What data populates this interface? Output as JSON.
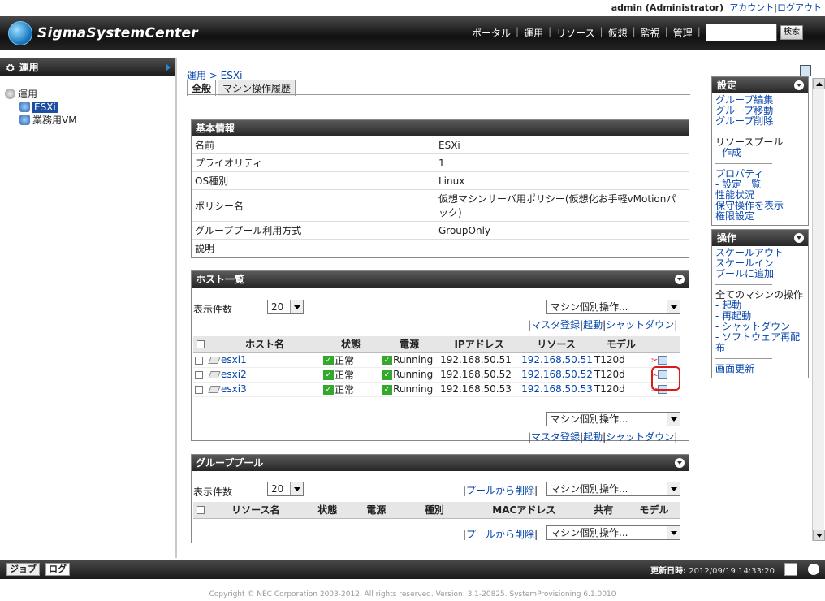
{
  "header": {
    "user": "admin (Administrator)",
    "account_link": "アカウント",
    "logout_link": "ログアウト",
    "app_name": "SigmaSystemCenter",
    "nav": [
      "ポータル",
      "運用",
      "リソース",
      "仮想",
      "監視",
      "管理"
    ],
    "search_button": "検索"
  },
  "left": {
    "title": "運用",
    "tree": [
      {
        "label": "運用"
      },
      {
        "label": "ESXi",
        "selected": true
      },
      {
        "label": "業務用VM"
      }
    ]
  },
  "main": {
    "breadcrumb": "運用 > ESXi",
    "tabs": [
      "全般",
      "マシン操作履歴"
    ],
    "basic": {
      "title": "基本情報",
      "rows": [
        {
          "k": "名前",
          "v": "ESXi"
        },
        {
          "k": "プライオリティ",
          "v": "1"
        },
        {
          "k": "OS種別",
          "v": "Linux"
        },
        {
          "k": "ポリシー名",
          "v": "仮想マシンサーバ用ポリシー(仮想化お手軽vMotionパック)"
        },
        {
          "k": "グループプール利用方式",
          "v": "GroupOnly"
        },
        {
          "k": "説明",
          "v": ""
        }
      ]
    },
    "hosts": {
      "title": "ホスト一覧",
      "count_label": "表示件数",
      "count_value": "20",
      "op_select": "マシン個別操作...",
      "links": [
        "マスタ登録",
        "起動",
        "シャットダウン"
      ],
      "columns": [
        "ホスト名",
        "状態",
        "電源",
        "IPアドレス",
        "リソース",
        "モデル"
      ],
      "rows": [
        {
          "name": "esxi1",
          "state": "正常",
          "power": "Running",
          "ip": "192.168.50.51",
          "res": "192.168.50.51",
          "model": "T120d"
        },
        {
          "name": "esxi2",
          "state": "正常",
          "power": "Running",
          "ip": "192.168.50.52",
          "res": "192.168.50.52",
          "model": "T120d"
        },
        {
          "name": "esxi3",
          "state": "正常",
          "power": "Running",
          "ip": "192.168.50.53",
          "res": "192.168.50.53",
          "model": "T120d"
        }
      ]
    },
    "pool": {
      "title": "グループプール",
      "count_label": "表示件数",
      "count_value": "20",
      "remove_link": "プールから削除",
      "op_select": "マシン個別操作...",
      "columns": [
        "リソース名",
        "状態",
        "電源",
        "種別",
        "MACアドレス",
        "共有",
        "モデル"
      ]
    }
  },
  "right": {
    "settings": {
      "title": "設定",
      "group1": [
        "グループ編集",
        "グループ移動",
        "グループ削除"
      ],
      "pool_label": "リソースプール",
      "pool_link": "- 作成",
      "prop_label": "プロパティ",
      "prop_links": [
        "- 設定一覧",
        "性能状況",
        "保守操作を表示",
        "権限設定"
      ]
    },
    "ops": {
      "title": "操作",
      "links": [
        "スケールアウト",
        "スケールイン",
        "プールに追加"
      ],
      "all_label": "全てのマシンの操作",
      "all_links": [
        "- 起動",
        "- 再起動",
        "- シャットダウン",
        "- ソフトウェア再配布"
      ],
      "refresh": "画面更新"
    }
  },
  "footer": {
    "tabs": [
      "ジョブ",
      "ログ"
    ],
    "updated_label": "更新日時:",
    "updated_value": "2012/09/19 14:33:20",
    "copyright": "Copyright © NEC Corporation 2003-2012. All rights reserved. Version: 3.1-20825. SystemProvisioning 6.1.0010"
  }
}
